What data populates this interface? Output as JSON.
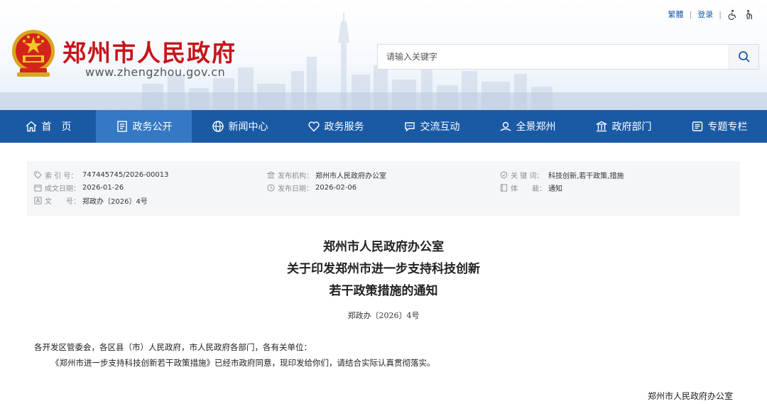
{
  "header": {
    "title": "郑州市人民政府",
    "url": "www.zhengzhou.gov.cn",
    "links": {
      "traditional": "繁體",
      "login": "登录",
      "separator": "|"
    },
    "search": {
      "placeholder": "请输入关键字"
    }
  },
  "nav": {
    "items": [
      {
        "label": "首　页",
        "icon": "home-icon"
      },
      {
        "label": "政务公开",
        "icon": "document-icon"
      },
      {
        "label": "新闻中心",
        "icon": "globe-icon"
      },
      {
        "label": "政务服务",
        "icon": "heart-icon"
      },
      {
        "label": "交流互动",
        "icon": "chat-icon"
      },
      {
        "label": "全景郑州",
        "icon": "panorama-icon"
      },
      {
        "label": "政府部门",
        "icon": "building-icon"
      },
      {
        "label": "专题专栏",
        "icon": "topic-icon"
      }
    ],
    "active_index": 1
  },
  "meta": {
    "index_label": "索 引 号：",
    "index_value": "747445745/2026-00013",
    "date_label": "成文日期：",
    "date_value": "2026-01-26",
    "docno_label": "文　　号：",
    "docno_value": "郑政办〔2026〕4号",
    "org_label": "发布机构：",
    "org_value": "郑州市人民政府办公室",
    "pub_label": "发布日期：",
    "pub_value": "2026-02-06",
    "kw_label": "关 键 词：",
    "kw_value": "科技创新,若干政策,措施",
    "genre_label": "体　　裁：",
    "genre_value": "通知"
  },
  "article": {
    "title_lines": [
      "郑州市人民政府办公室",
      "关于印发郑州市进一步支持科技创新",
      "若干政策措施的通知"
    ],
    "doc_no": "郑政办〔2026〕4号",
    "salutation": "各开发区管委会，各区县（市）人民政府，市人民政府各部门，各有关单位：",
    "body": "《郑州市进一步支持科技创新若干政策措施》已经市政府同意，现印发给你们，请结合实际认真贯彻落实。",
    "signature": "郑州市人民政府办公室"
  },
  "colors": {
    "nav_bg": "#1a5aa5",
    "nav_active": "#3579c4",
    "title_red": "#c6151a"
  }
}
